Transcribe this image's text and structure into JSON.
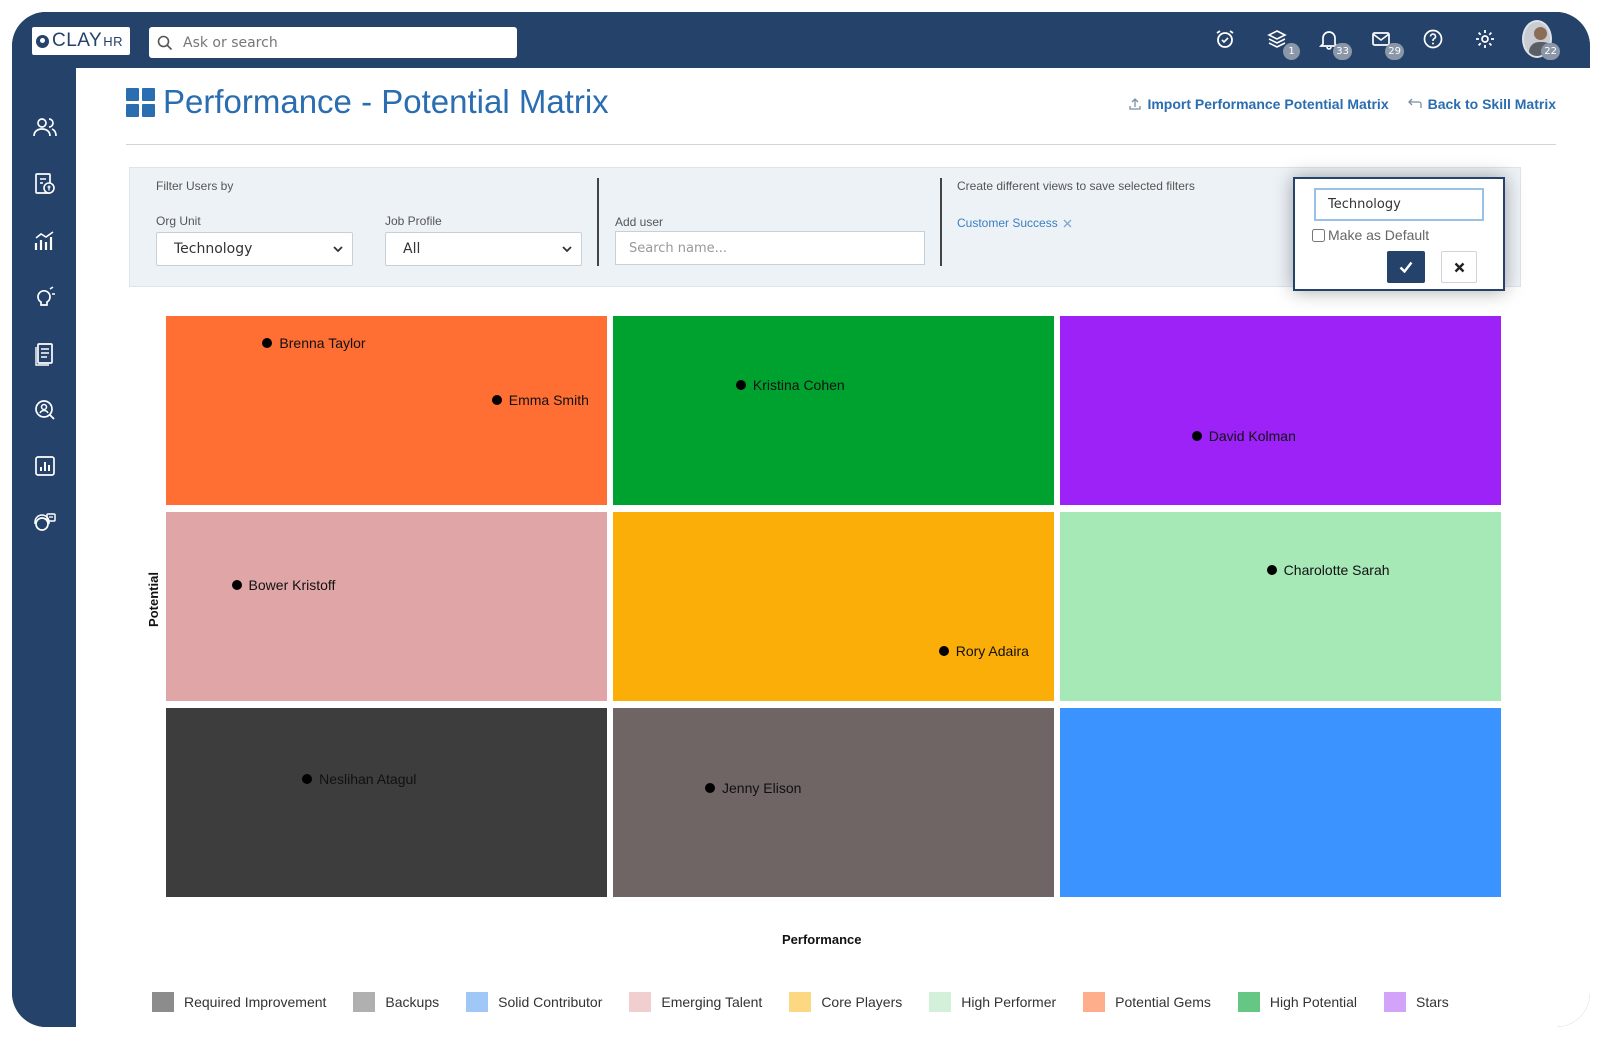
{
  "app": {
    "logo_main": "CLAY",
    "logo_sub": "HR",
    "search_placeholder": "Ask or search",
    "badges": {
      "layers": "1",
      "notifications": "33",
      "messages": "29",
      "profile": "22"
    }
  },
  "page": {
    "title": "Performance - Potential Matrix",
    "import_link": "Import Performance Potential Matrix",
    "back_link": "Back to Skill Matrix"
  },
  "filters": {
    "filter_heading": "Filter Users by",
    "org_unit_label": "Org Unit",
    "org_unit_value": "Technology",
    "job_profile_label": "Job Profile",
    "job_profile_value": "All",
    "add_user_label": "Add user",
    "add_user_placeholder": "Search name...",
    "views_heading": "Create different views to save selected filters",
    "saved_view": "Customer Success"
  },
  "save_view": {
    "name_value": "Technology",
    "make_default_label": "Make as Default"
  },
  "chart_data": {
    "type": "heatmap",
    "xlabel": "Performance",
    "ylabel": "Potential",
    "rows": 3,
    "cols": 3,
    "cells": [
      {
        "row": 0,
        "col": 0,
        "color": "#ff6e33",
        "people": [
          {
            "name": "Brenna Taylor",
            "x": 0.23,
            "y": 0.15
          },
          {
            "name": "Emma Smith",
            "x": 0.75,
            "y": 0.45
          }
        ]
      },
      {
        "row": 0,
        "col": 1,
        "color": "#00a22f",
        "people": [
          {
            "name": "Kristina Cohen",
            "x": 0.29,
            "y": 0.37
          }
        ]
      },
      {
        "row": 0,
        "col": 2,
        "color": "#9c22f7",
        "people": [
          {
            "name": "David Kolman",
            "x": 0.31,
            "y": 0.64
          }
        ]
      },
      {
        "row": 1,
        "col": 0,
        "color": "#e0a6a7",
        "people": [
          {
            "name": "Bower Kristoff",
            "x": 0.16,
            "y": 0.39
          }
        ]
      },
      {
        "row": 1,
        "col": 1,
        "color": "#fbad08",
        "people": [
          {
            "name": "Rory Adaira",
            "x": 0.75,
            "y": 0.74
          }
        ]
      },
      {
        "row": 1,
        "col": 2,
        "color": "#a7e8b7",
        "people": [
          {
            "name": "Charolotte Sarah",
            "x": 0.48,
            "y": 0.31
          }
        ]
      },
      {
        "row": 2,
        "col": 0,
        "color": "#3d3d3d",
        "people": [
          {
            "name": "Neslihan Atagul",
            "x": 0.32,
            "y": 0.38
          }
        ]
      },
      {
        "row": 2,
        "col": 1,
        "color": "#6e6564",
        "people": [
          {
            "name": "Jenny Elison",
            "x": 0.22,
            "y": 0.43
          }
        ]
      },
      {
        "row": 2,
        "col": 2,
        "color": "#3a93fe",
        "people": []
      }
    ],
    "legend": [
      {
        "label": "Required Improvement",
        "color": "#8c8c8c"
      },
      {
        "label": "Backups",
        "color": "#b0b0b0"
      },
      {
        "label": "Solid Contributor",
        "color": "#a0c8f7"
      },
      {
        "label": "Emerging Talent",
        "color": "#f1cfd0"
      },
      {
        "label": "Core Players",
        "color": "#fcd883"
      },
      {
        "label": "High Performer",
        "color": "#d3f1da"
      },
      {
        "label": "Potential Gems",
        "color": "#ffae8c"
      },
      {
        "label": "High Potential",
        "color": "#66c784"
      },
      {
        "label": "Stars",
        "color": "#d3a2f9"
      }
    ]
  }
}
